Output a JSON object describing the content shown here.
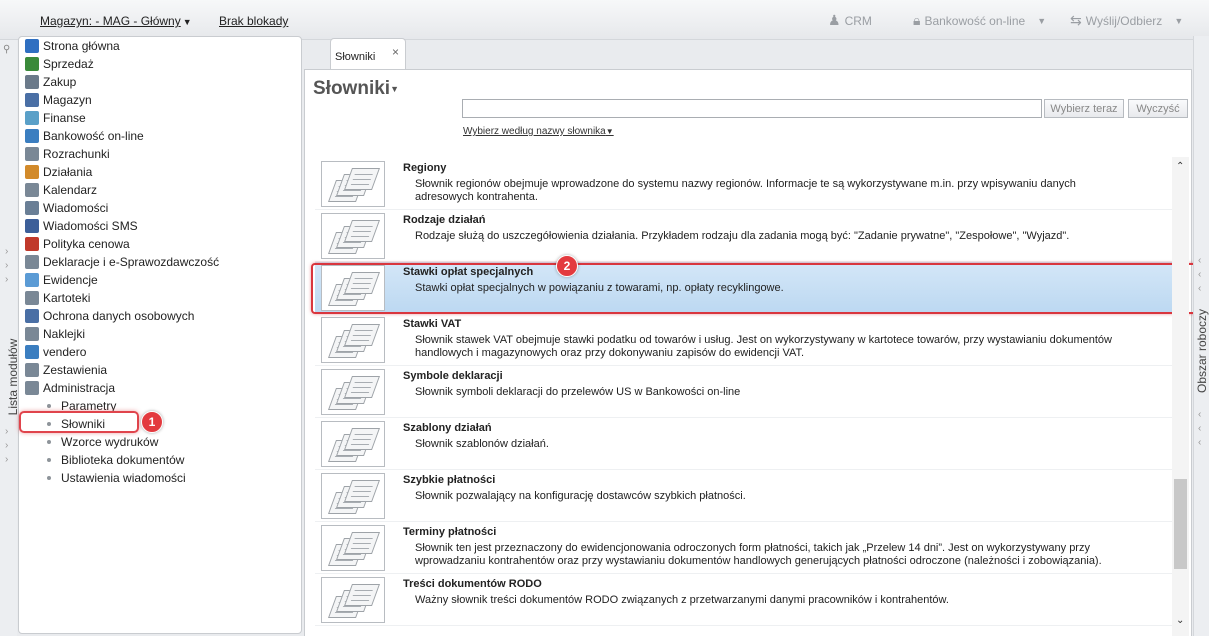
{
  "topbar": {
    "magazyn": "Magazyn: - MAG - Główny",
    "blokady": "Brak blokady",
    "crm": "CRM",
    "bankowosc": "Bankowość on-line",
    "wyslij": "Wyślij/Odbierz"
  },
  "left_tab_label": "Lista modułów",
  "right_tab_label": "Obszar roboczy",
  "nav": {
    "items": [
      {
        "label": "Strona główna",
        "icon": "home-icon",
        "color": "#2f6fc1"
      },
      {
        "label": "Sprzedaż",
        "icon": "sales-icon",
        "color": "#3a8a3a"
      },
      {
        "label": "Zakup",
        "icon": "cart-icon",
        "color": "#6b7a8a"
      },
      {
        "label": "Magazyn",
        "icon": "warehouse-icon",
        "color": "#4a6fa5"
      },
      {
        "label": "Finanse",
        "icon": "finance-icon",
        "color": "#5aa0c8"
      },
      {
        "label": "Bankowość on-line",
        "icon": "bank-icon",
        "color": "#3b7ec0"
      },
      {
        "label": "Rozrachunki",
        "icon": "settlements-icon",
        "color": "#7a8896"
      },
      {
        "label": "Działania",
        "icon": "actions-icon",
        "color": "#d28a2a"
      },
      {
        "label": "Kalendarz",
        "icon": "calendar-icon",
        "color": "#7a8896"
      },
      {
        "label": "Wiadomości",
        "icon": "mail-icon",
        "color": "#6a7f96"
      },
      {
        "label": "Wiadomości SMS",
        "icon": "sms-icon",
        "color": "#3d5f99"
      },
      {
        "label": "Polityka cenowa",
        "icon": "price-icon",
        "color": "#c0392b"
      },
      {
        "label": "Deklaracje i e-Sprawozdawczość",
        "icon": "declarations-icon",
        "color": "#7a8896"
      },
      {
        "label": "Ewidencje",
        "icon": "records-icon",
        "color": "#5b9bd5"
      },
      {
        "label": "Kartoteki",
        "icon": "files-icon",
        "color": "#7a8896"
      },
      {
        "label": "Ochrona danych osobowych",
        "icon": "shield-icon",
        "color": "#4a6fa5"
      },
      {
        "label": "Naklejki",
        "icon": "stickers-icon",
        "color": "#7a8896"
      },
      {
        "label": "vendero",
        "icon": "gear-icon",
        "color": "#3b7ec0"
      },
      {
        "label": "Zestawienia",
        "icon": "reports-icon",
        "color": "#7a8896"
      },
      {
        "label": "Administracja",
        "icon": "admin-icon",
        "color": "#7a8896"
      }
    ],
    "sub": [
      "Parametry",
      "Słowniki",
      "Wzorce wydruków",
      "Biblioteka dokumentów",
      "Ustawienia wiadomości"
    ]
  },
  "tab": {
    "label": "Słowniki",
    "close": "×"
  },
  "main": {
    "title": "Słowniki",
    "search_value": "",
    "search_button": "Wybierz teraz",
    "clear_button": "Wyczyść",
    "choose_link": "Wybierz według nazwy słownika"
  },
  "rows": [
    {
      "name": "Regiony",
      "desc": "Słownik regionów obejmuje wprowadzone do systemu nazwy regionów. Informacje te są wykorzystywane m.in. przy wpisywaniu danych adresowych kontrahenta."
    },
    {
      "name": "Rodzaje działań",
      "desc": "Rodzaje służą do uszczegółowienia działania. Przykładem rodzaju dla zadania mogą być: \"Zadanie prywatne\", \"Zespołowe\", \"Wyjazd\"."
    },
    {
      "name": "Stawki opłat specjalnych",
      "desc": "Stawki opłat specjalnych w powiązaniu z towarami, np. opłaty recyklingowe."
    },
    {
      "name": "Stawki VAT",
      "desc": "Słownik stawek VAT obejmuje stawki podatku od towarów i usług. Jest on wykorzystywany w kartotece towarów, przy wystawianiu dokumentów handlowych i magazynowych oraz przy dokonywaniu zapisów do ewidencji VAT."
    },
    {
      "name": "Symbole deklaracji",
      "desc": "Słownik symboli deklaracji do przelewów US w Bankowości on-line"
    },
    {
      "name": "Szablony działań",
      "desc": "Słownik szablonów działań."
    },
    {
      "name": "Szybkie płatności",
      "desc": "Słownik pozwalający na konfigurację dostawców szybkich płatności."
    },
    {
      "name": "Terminy płatności",
      "desc": "Słownik ten jest przeznaczony do ewidencjonowania odroczonych form płatności, takich jak „Przelew 14 dni”. Jest on wykorzystywany przy wprowadzaniu kontrahentów oraz przy wystawianiu dokumentów handlowych generujących płatności odroczone (należności i zobowiązania)."
    },
    {
      "name": "Treści dokumentów RODO",
      "desc": "Ważny słownik treści dokumentów RODO związanych z przetwarzanymi danymi pracowników i kontrahentów."
    }
  ],
  "badges": [
    "1",
    "2"
  ]
}
